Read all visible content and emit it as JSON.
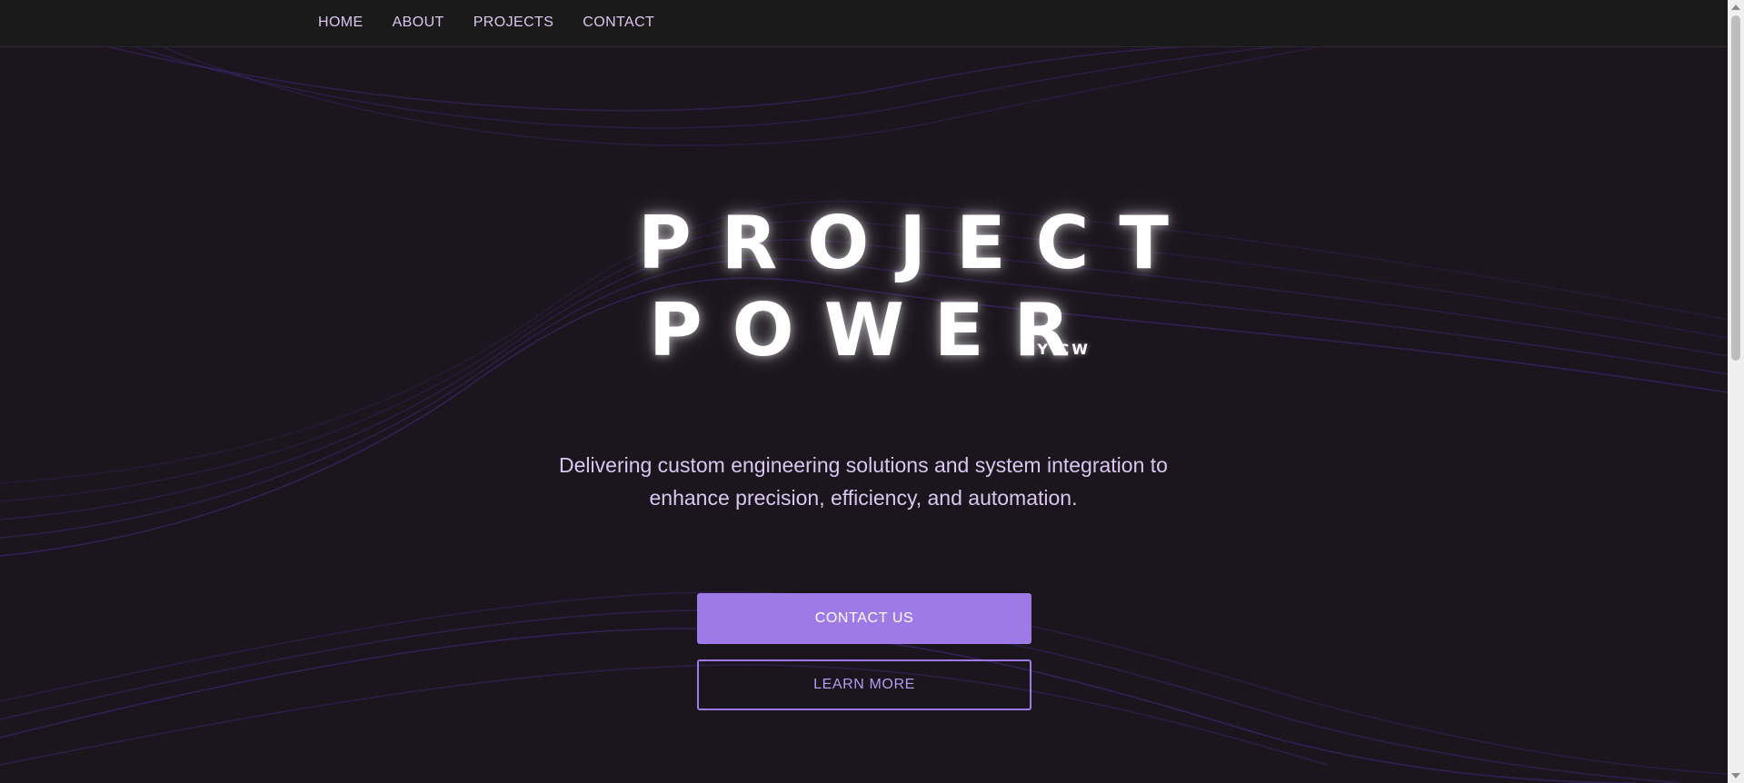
{
  "nav": {
    "items": [
      {
        "label": "HOME"
      },
      {
        "label": "ABOUT"
      },
      {
        "label": "PROJECTS"
      },
      {
        "label": "CONTACT"
      }
    ]
  },
  "hero": {
    "title_line_1": "PROJECT",
    "title_line_2": "POWER",
    "byline": "BY CW",
    "tagline_line_1": "Delivering custom engineering solutions and system integration to",
    "tagline_line_2": "enhance precision, efficiency, and automation.",
    "primary_button": "CONTACT US",
    "secondary_button": "LEARN MORE"
  },
  "colors": {
    "background": "#1b161d",
    "nav_background": "#1a1a1a",
    "accent": "#9d7ae6",
    "text_light": "#d9c7f0",
    "wave": "#5a2fa8"
  }
}
